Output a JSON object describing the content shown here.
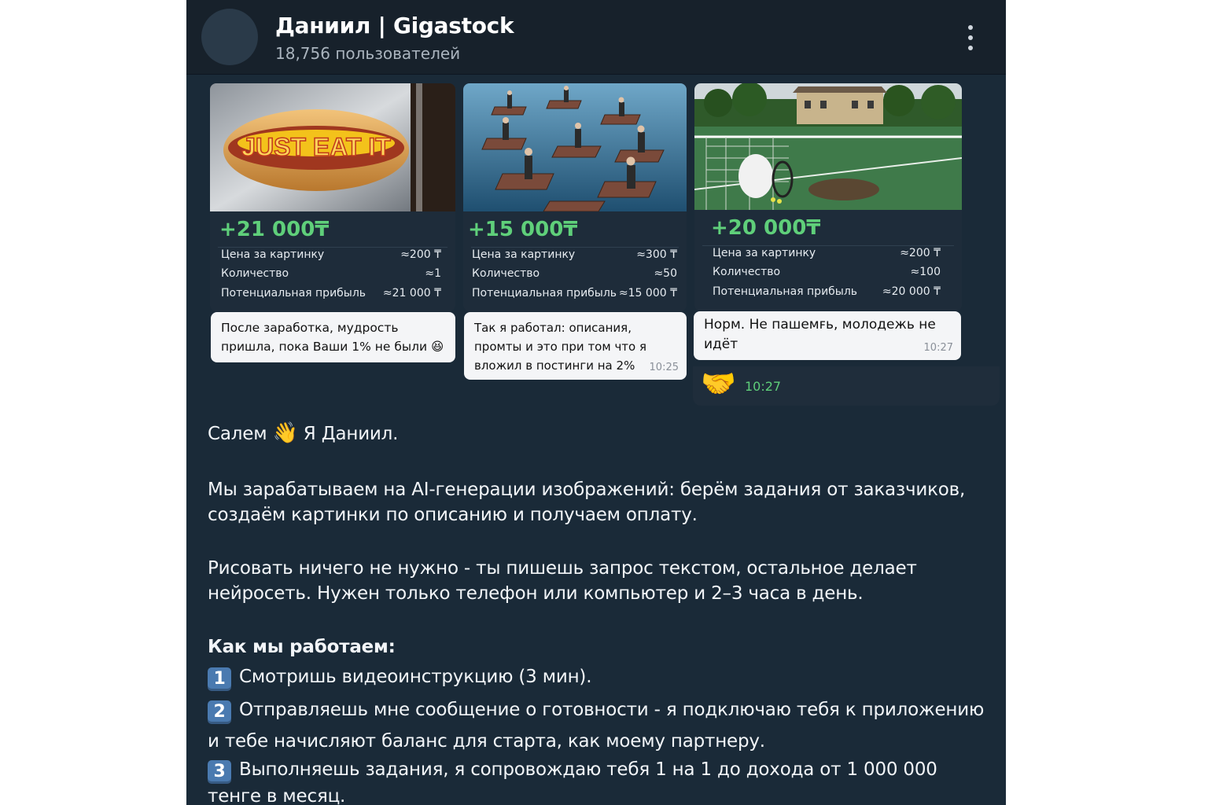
{
  "header": {
    "title": "Даниил | Gigastock",
    "subtitle": "18,756 пользователей"
  },
  "cards": [
    {
      "photo_text": "JUST EAT IT",
      "gain": "+21 000₸",
      "rows": [
        {
          "label": "Цена за картинку",
          "value": "≈200 ₸"
        },
        {
          "label": "Количество",
          "value": "≈1"
        },
        {
          "label": "Потенциальная прибыль",
          "value": "≈21 000 ₸"
        }
      ],
      "bubble_text": "После заработка, мудрость пришла, пока Ваши 1% не были",
      "bubble_emoji": "😆",
      "bubble_time": ""
    },
    {
      "gain": "+15 000₸",
      "rows": [
        {
          "label": "Цена за картинку",
          "value": "≈300 ₸"
        },
        {
          "label": "Количество",
          "value": "≈50"
        },
        {
          "label": "Потенциальная прибыль",
          "value": "≈15 000 ₸"
        }
      ],
      "bubble_text": "Так я работал: описания, промты и это при том что я вложил в постинги на 2%",
      "bubble_time": "10:25"
    },
    {
      "gain": "+20 000₸",
      "rows": [
        {
          "label": "Цена за картинку",
          "value": "≈200 ₸"
        },
        {
          "label": "Количество",
          "value": "≈100"
        },
        {
          "label": "Потенциальная прибыль",
          "value": "≈20 000 ₸"
        }
      ],
      "bubble_text": "Норм. Не пашемꜰь, молодежь не идёт",
      "bubble_time": "10:27"
    }
  ],
  "reaction": {
    "emoji": "🤝",
    "time": "10:27"
  },
  "message": {
    "greeting_pre": "Салем",
    "greeting_emoji": "👋",
    "greeting_post": "Я Даниил.",
    "p1": "Мы зарабатываем на AI-генерации изображений: берём задания от заказчиков, создаём картинки по описанию и получаем оплату.",
    "p2": "Рисовать ничего не нужно - ты пишешь запрос текстом, остальное делает нейросеть. Нужен только телефон или компьютер и 2–3 часа в день.",
    "how_title": "Как мы работаем:",
    "steps": [
      {
        "num": "1",
        "text": "Смотришь видеоинструкцию (3 мин)."
      },
      {
        "num": "2",
        "text": "Отправляешь мне сообщение о готовности - я подключаю тебя к приложению и тебе начисляют баланс для старта, как моему партнеру."
      },
      {
        "num": "3",
        "text": "Выполняешь задания, я сопровождаю тебя 1 на 1 до дохода от 1 000 000 тенге в месяц."
      }
    ]
  },
  "colors": {
    "background": "#17212b",
    "accent_green": "#5fcf7a",
    "bubble": "#f4f5f7"
  }
}
